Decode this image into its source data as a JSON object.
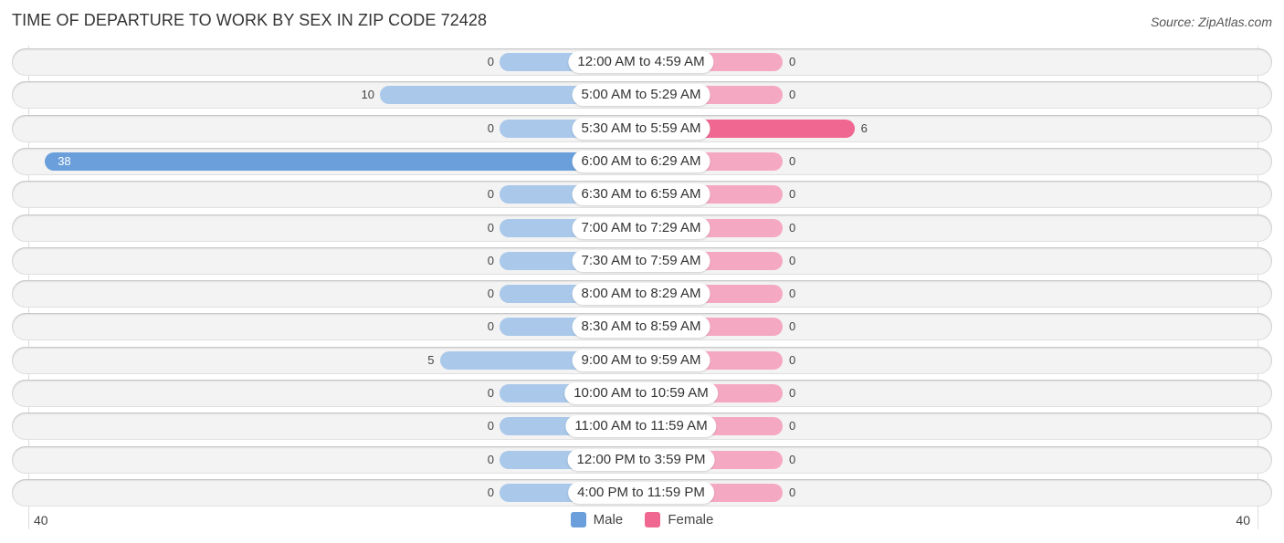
{
  "title": "TIME OF DEPARTURE TO WORK BY SEX IN ZIP CODE 72428",
  "source": "Source: ZipAtlas.com",
  "colors": {
    "male": "#6a9fdb",
    "male_light": "#a9c8ea",
    "female": "#f06892",
    "female_light": "#f5a8c2"
  },
  "chart_data": {
    "type": "bar",
    "orientation": "horizontal-diverging",
    "title": "TIME OF DEPARTURE TO WORK BY SEX IN ZIP CODE 72428",
    "categories": [
      "12:00 AM to 4:59 AM",
      "5:00 AM to 5:29 AM",
      "5:30 AM to 5:59 AM",
      "6:00 AM to 6:29 AM",
      "6:30 AM to 6:59 AM",
      "7:00 AM to 7:29 AM",
      "7:30 AM to 7:59 AM",
      "8:00 AM to 8:29 AM",
      "8:30 AM to 8:59 AM",
      "9:00 AM to 9:59 AM",
      "10:00 AM to 10:59 AM",
      "11:00 AM to 11:59 AM",
      "12:00 PM to 3:59 PM",
      "4:00 PM to 11:59 PM"
    ],
    "series": [
      {
        "name": "Male",
        "values": [
          0,
          10,
          0,
          38,
          0,
          0,
          0,
          0,
          0,
          5,
          0,
          0,
          0,
          0
        ]
      },
      {
        "name": "Female",
        "values": [
          0,
          0,
          6,
          0,
          0,
          0,
          0,
          0,
          0,
          0,
          0,
          0,
          0,
          0
        ]
      }
    ],
    "xlim": [
      -40,
      40
    ],
    "tick_labels": {
      "left": "40",
      "right": "40"
    },
    "legend": {
      "position": "bottom-center",
      "entries": [
        "Male",
        "Female"
      ]
    }
  }
}
